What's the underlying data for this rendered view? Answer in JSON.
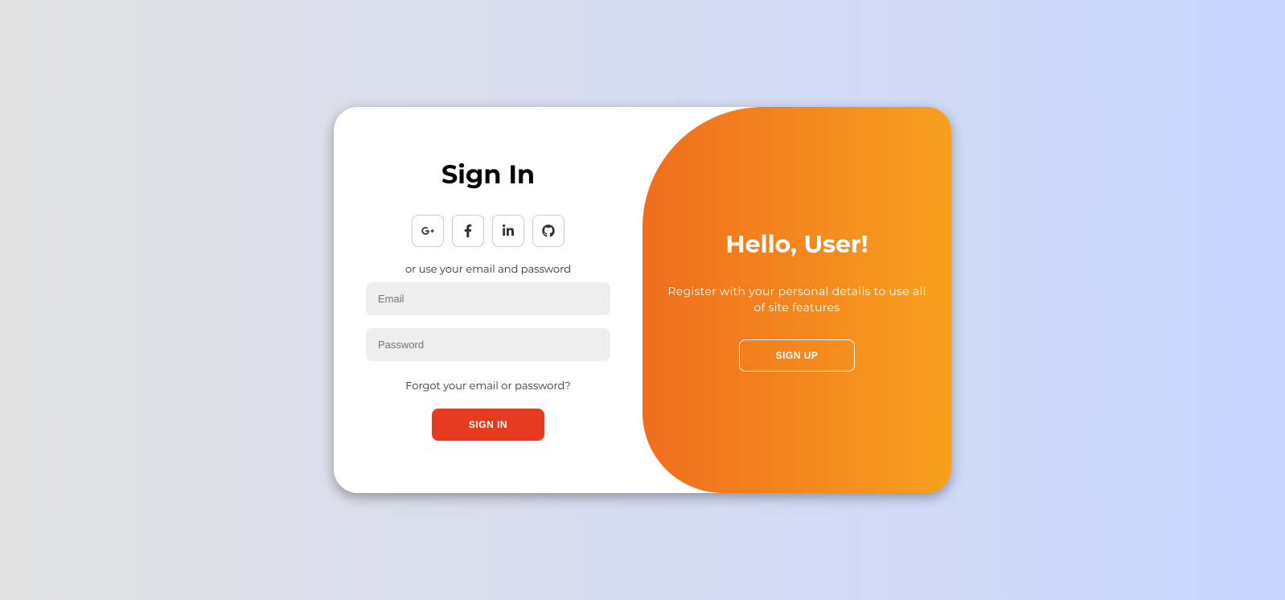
{
  "signin": {
    "title": "Sign In",
    "altText": "or use your email and password",
    "emailPlaceholder": "Email",
    "passwordPlaceholder": "Password",
    "forgotText": "Forgot your email or password?",
    "submitButton": "Sign In"
  },
  "togglePanel": {
    "title": "Hello, User!",
    "description": "Register with your personal details to use all of site features",
    "button": "Sign Up"
  },
  "socialIcons": [
    "google-plus",
    "facebook",
    "linkedin",
    "github"
  ]
}
